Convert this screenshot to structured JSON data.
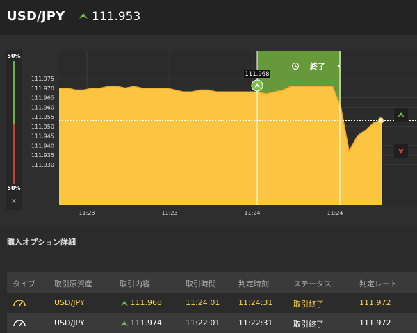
{
  "header": {
    "pair": "USD/JPY",
    "price": "111.953",
    "trend": "up"
  },
  "chart_data": {
    "type": "area",
    "y_ticks": [
      "111.975",
      "111.970",
      "111.965",
      "111.960",
      "111.955",
      "111.950",
      "111.945",
      "111.940",
      "111.935",
      "111.930"
    ],
    "x_ticks": [
      "11:23",
      "11:23",
      "11:24",
      "11:24"
    ],
    "ylim": [
      111.925,
      111.98
    ],
    "current_rate": 111.953,
    "marker": {
      "label": "111.968",
      "value": 111.968
    },
    "expiry_label": "終了",
    "series": [
      {
        "values": [
          111.97,
          111.97,
          111.969,
          111.969,
          111.97,
          111.97,
          111.971,
          111.971,
          111.97,
          111.971,
          111.97,
          111.97,
          111.97,
          111.97,
          111.969,
          111.968,
          111.968,
          111.969,
          111.969,
          111.968,
          111.968,
          111.968,
          111.968,
          111.968,
          111.968,
          111.967,
          111.968,
          111.969,
          111.971,
          111.971,
          111.971,
          111.971,
          111.971,
          111.971,
          111.96,
          111.937,
          111.945,
          111.948,
          111.952,
          111.953
        ]
      }
    ],
    "colors": {
      "fill": "#fcc541",
      "line": "#f0a020",
      "zone": "#66993a"
    }
  },
  "gauge": {
    "top": "50%",
    "bottom": "50%",
    "close": "×"
  },
  "buttons": {
    "high": "high",
    "low": "low"
  },
  "section": {
    "title": "購入オプション詳細"
  },
  "table": {
    "headers": [
      "タイプ",
      "取引原資産",
      "取引内容",
      "取引時間",
      "判定時刻",
      "ステータス",
      "判定レート"
    ],
    "rows": [
      {
        "asset": "USD/JPY",
        "rate": "111.968",
        "time": "11:24:01",
        "judge_time": "11:24:31",
        "status": "取引終了",
        "judge_rate": "111.972"
      },
      {
        "asset": "USD/JPY",
        "rate": "111.974",
        "time": "11:22:01",
        "judge_time": "11:22:31",
        "status": "取引終了",
        "judge_rate": "111.972"
      }
    ]
  }
}
